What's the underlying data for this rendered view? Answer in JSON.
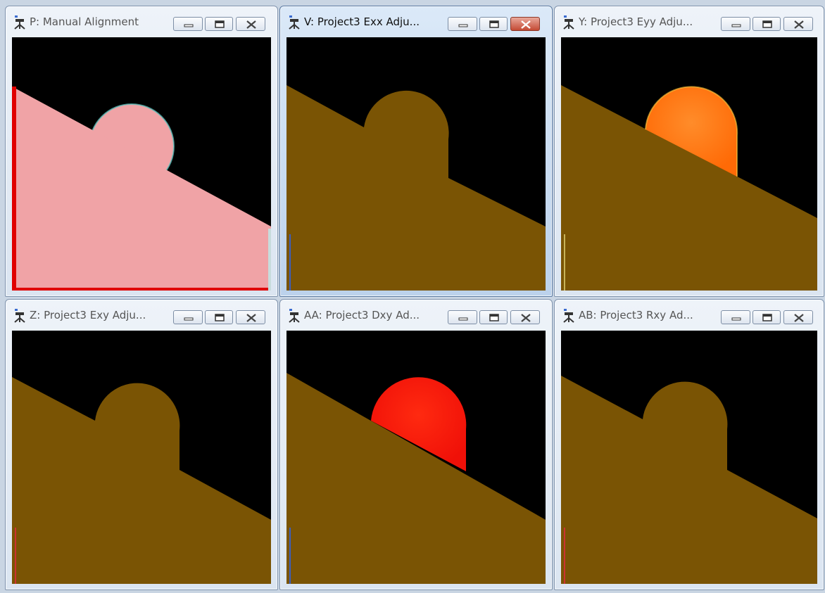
{
  "windows": [
    {
      "id": "P",
      "title": "P: Manual Alignment",
      "view": "manual-alignment",
      "active": false
    },
    {
      "id": "V",
      "title": "V: Project3 Exx Adju...",
      "view": "strain-exx",
      "active": true
    },
    {
      "id": "Y",
      "title": "Y: Project3 Eyy Adju...",
      "view": "strain-eyy",
      "active": false
    },
    {
      "id": "Z",
      "title": "Z: Project3 Exy Adju...",
      "view": "strain-exy",
      "active": false
    },
    {
      "id": "AA",
      "title": "AA: Project3 Dxy Ad...",
      "view": "strain-dxy",
      "active": false
    },
    {
      "id": "AB",
      "title": "AB: Project3 Rxy Ad...",
      "view": "strain-rxy",
      "active": false
    }
  ],
  "icons": {
    "app": "camera-stand-icon",
    "minimize": "minimize-icon",
    "maximize": "maximize-icon",
    "close": "close-icon"
  },
  "colors": {
    "masked_region": "#7a5404",
    "alignment_overlay": "#f0a3a6",
    "alignment_background": "#000000",
    "alignment_edge": "#e00000",
    "circle_eyy": "#ff7a12",
    "circle_dxy": "#ff1a0a"
  }
}
